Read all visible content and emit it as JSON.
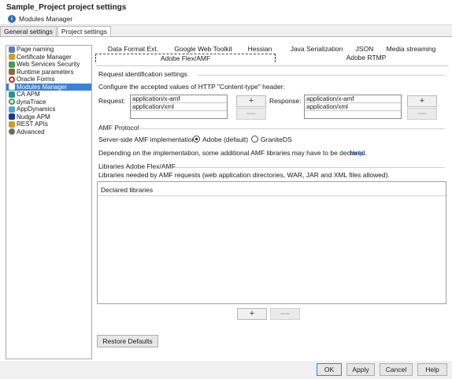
{
  "window": {
    "title": "Sample_Project project settings",
    "subtitle": "Modules Manager"
  },
  "outer_tabs": [
    {
      "label": "General settings",
      "active": false
    },
    {
      "label": "Project settings",
      "active": true
    }
  ],
  "sidebar": {
    "items": [
      {
        "label": "Page naming",
        "icon": "page-naming-icon",
        "color": "#5b7fb8",
        "selected": false
      },
      {
        "label": "Certificate Manager",
        "icon": "certificate-icon",
        "color": "#d89b2b",
        "selected": false
      },
      {
        "label": "Web Services Security",
        "icon": "web-services-icon",
        "color": "#4a9a4a",
        "selected": false
      },
      {
        "label": "Runtime parameters",
        "icon": "runtime-icon",
        "color": "#8a6a3a",
        "selected": false
      },
      {
        "label": "Oracle Forms",
        "icon": "oracle-icon",
        "color": "#cc2222",
        "selected": false
      },
      {
        "label": "Modules Manager",
        "icon": "modules-icon",
        "color": "#2a66b0",
        "selected": true
      },
      {
        "label": "CA APM",
        "icon": "ca-apm-icon",
        "color": "#1f9a8a",
        "selected": false
      },
      {
        "label": "dynaTrace",
        "icon": "dynatrace-icon",
        "color": "#3aa03a",
        "selected": false
      },
      {
        "label": "AppDynamics",
        "icon": "appdynamics-icon",
        "color": "#5aa0d8",
        "selected": false
      },
      {
        "label": "Nudge APM",
        "icon": "nudge-icon",
        "color": "#1a3a8a",
        "selected": false
      },
      {
        "label": "REST APIs",
        "icon": "rest-icon",
        "color": "#c8a020",
        "selected": false
      },
      {
        "label": "Advanced",
        "icon": "advanced-gear-icon",
        "color": "#6a6a6a",
        "selected": false
      }
    ]
  },
  "protocol_tabs": {
    "row1": [
      "Data Format Ext.",
      "Google Web Toolkit",
      "Hessian",
      "Java Serialization",
      "JSON",
      "Media streaming"
    ],
    "row2": [
      "Adobe Flex/AMF",
      "Adobe RTMP"
    ],
    "active": "Adobe Flex/AMF"
  },
  "request_section": {
    "title": "Request identification settings",
    "description": "Configure the accepted values of HTTP \"Content-type\" header:",
    "request_label": "Request:",
    "request_values": [
      "application/x-amf",
      "application/xml"
    ],
    "response_label": "Response:",
    "response_values": [
      "application/x-amf",
      "application/xml"
    ],
    "add_label": "+",
    "remove_label": "—"
  },
  "amf_section": {
    "title": "AMF Protocol",
    "impl_label": "Server-side AMF implementation:",
    "option_adobe": "Adobe (default)",
    "option_granite": "GraniteDS",
    "selected": "adobe",
    "note": "Depending on the implementation, some additional AMF libraries may have to be declared.",
    "help_link": "Help"
  },
  "libraries_section": {
    "title": "Libraries Adobe Flex/AMF",
    "description": "Libraries needed by AMF requests (web application directories, WAR, JAR and XML files allowed).",
    "list_header": "Declared libraries",
    "add_label": "+",
    "remove_label": "—"
  },
  "restore_defaults": "Restore Defaults",
  "footer": {
    "ok": "OK",
    "apply": "Apply",
    "cancel": "Cancel",
    "help": "Help"
  }
}
